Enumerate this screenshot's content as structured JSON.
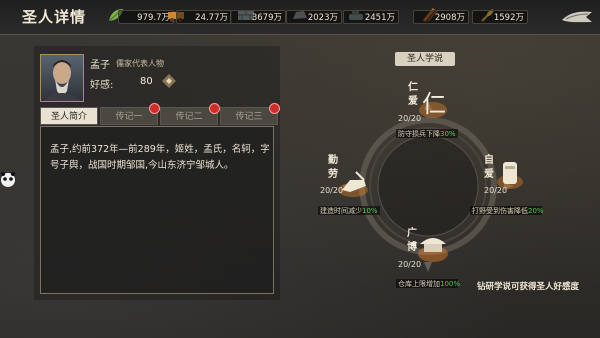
{
  "header": {
    "title": "圣人详情",
    "resources": [
      {
        "icon": "leaf-icon",
        "value": "979.7万"
      },
      {
        "icon": "cart-icon",
        "value": "24.77万"
      },
      {
        "icon": "brick-icon",
        "value": "3679万"
      },
      {
        "icon": "stone-icon",
        "value": "2023万"
      },
      {
        "icon": "tank-icon",
        "value": "2451万"
      },
      {
        "icon": "wood-icon",
        "value": "2908万"
      },
      {
        "icon": "wheat-icon",
        "value": "1592万"
      }
    ],
    "close_icon": "close-icon"
  },
  "sage": {
    "name": "孟子",
    "tag": "儒家代表人物",
    "fav_label": "好感:",
    "fav_value": "80"
  },
  "tabs": [
    {
      "label": "圣人简介",
      "active": true
    },
    {
      "label": "传记一",
      "active": false
    },
    {
      "label": "传记二",
      "active": false
    },
    {
      "label": "传记三",
      "active": false
    }
  ],
  "bio": "孟子,约前372年—前289年，姬姓，孟氏，名轲，字号子舆，战国时期邹国,今山东济宁邹城人。",
  "doctrine": {
    "title": "圣人学说",
    "virtues": [
      {
        "label_top": "仁",
        "label_bottom": "爱",
        "count": "20/20",
        "effect": "防守损兵下降",
        "pct": "30%"
      },
      {
        "label_top": "自",
        "label_bottom": "爱",
        "count": "20/20",
        "effect": "打野受到伤害降低",
        "pct": "20%"
      },
      {
        "label_top": "广",
        "label_bottom": "博",
        "count": "20/20",
        "effect": "仓库上限增加",
        "pct": "100%"
      },
      {
        "label_top": "勤",
        "label_bottom": "劳",
        "count": "20/20",
        "effect": "建造时间减少",
        "pct": "10%"
      }
    ],
    "hint": "钻研学说可获得圣人好感度"
  },
  "colors": {
    "accent_green": "#4ec94e",
    "badge_red": "#d12c2c",
    "gold": "#a88e5a"
  }
}
